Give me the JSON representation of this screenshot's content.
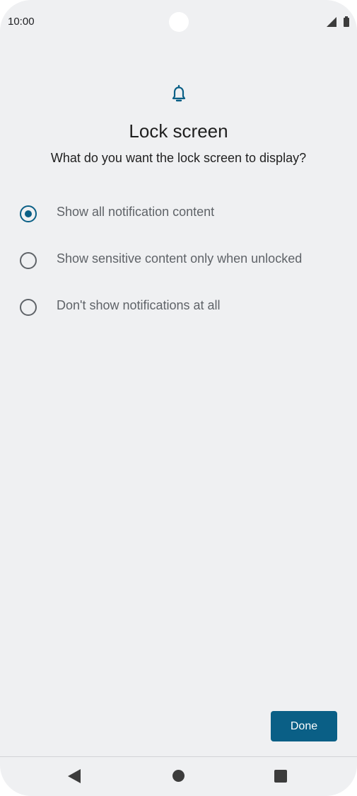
{
  "status_bar": {
    "time": "10:00"
  },
  "header": {
    "icon": "bell-icon",
    "title": "Lock screen",
    "subtitle": "What do you want the lock screen to display?"
  },
  "options": [
    {
      "label": "Show all notification content",
      "selected": true
    },
    {
      "label": "Show sensitive content only when unlocked",
      "selected": false
    },
    {
      "label": "Don't show notifications at all",
      "selected": false
    }
  ],
  "footer": {
    "done_label": "Done"
  },
  "colors": {
    "background": "#eff0f2",
    "accent": "#0a5f86",
    "option_text": "#5f6368",
    "title_text": "#1f1f1f"
  }
}
